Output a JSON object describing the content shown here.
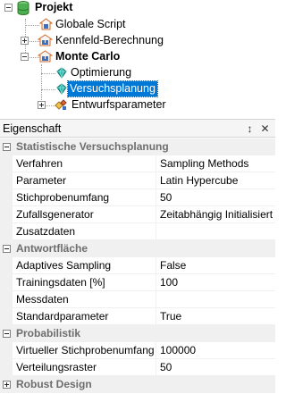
{
  "tree": {
    "items": [
      {
        "label": "Projekt",
        "icon": "database-icon"
      },
      {
        "label": "Globale Script",
        "icon": "script-icon"
      },
      {
        "label": "Kennfeld-Berechnung",
        "icon": "network-icon"
      },
      {
        "label": "Monte Carlo",
        "icon": "network-icon"
      },
      {
        "label": "Optimierung",
        "icon": "gem-icon"
      },
      {
        "label": "Versuchsplanung",
        "icon": "gem-icon"
      },
      {
        "label": "Entwurfsparameter",
        "icon": "parameter-icon"
      }
    ],
    "selected": "Versuchsplanung"
  },
  "panel": {
    "title": "Eigenschaft",
    "pin_glyph": "↕",
    "close_glyph": "✕"
  },
  "grid": {
    "categories": [
      {
        "name": "Statistische Versuchsplanung",
        "expanded": true,
        "props": [
          {
            "name": "Verfahren",
            "value": "Sampling Methods"
          },
          {
            "name": "Parameter",
            "value": "Latin Hypercube"
          },
          {
            "name": "Stichprobenumfang",
            "value": "50"
          },
          {
            "name": "Zufallsgenerator",
            "value": "Zeitabhängig Initialisiert"
          },
          {
            "name": "Zusatzdaten",
            "value": ""
          }
        ]
      },
      {
        "name": "Antwortfläche",
        "expanded": true,
        "props": [
          {
            "name": "Adaptives Sampling",
            "value": "False"
          },
          {
            "name": "Trainingsdaten [%]",
            "value": "100"
          },
          {
            "name": "Messdaten",
            "value": ""
          },
          {
            "name": "Standardparameter",
            "value": "True"
          }
        ]
      },
      {
        "name": "Probabilistik",
        "expanded": true,
        "props": [
          {
            "name": "Virtueller Stichprobenumfang",
            "value": "100000"
          },
          {
            "name": "Verteilungsraster",
            "value": "50"
          }
        ]
      },
      {
        "name": "Robust Design",
        "expanded": false,
        "props": []
      }
    ]
  },
  "colors": {
    "selection": "#0078d7",
    "category_text": "#6d6d6d",
    "category_bg": "#f0f0f0"
  }
}
